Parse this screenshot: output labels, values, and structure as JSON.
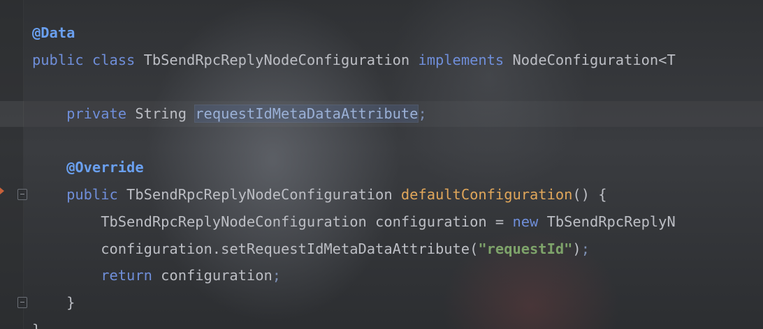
{
  "editor": {
    "lines": [
      {
        "tokens": [
          {
            "cls": "ann-blue",
            "text": "@Data"
          }
        ]
      },
      {
        "tokens": [
          {
            "cls": "kw",
            "text": "public class "
          },
          {
            "cls": "ty",
            "text": "TbSendRpcReplyNodeConfiguration "
          },
          {
            "cls": "kw",
            "text": "implements "
          },
          {
            "cls": "ty",
            "text": "NodeConfiguration<T"
          }
        ]
      },
      {
        "tokens": []
      },
      {
        "tokens": [
          {
            "cls": "kw",
            "text": "    private "
          },
          {
            "cls": "ty",
            "text": "String "
          },
          {
            "cls": "field-hl",
            "text": "requestIdMetaDataAttribute"
          },
          {
            "cls": "semi",
            "text": ";"
          }
        ]
      },
      {
        "tokens": []
      },
      {
        "tokens": [
          {
            "cls": "ann-blue",
            "text": "    @Override"
          }
        ]
      },
      {
        "tokens": [
          {
            "cls": "kw",
            "text": "    public "
          },
          {
            "cls": "ty",
            "text": "TbSendRpcReplyNodeConfiguration "
          },
          {
            "cls": "fn",
            "text": "defaultConfiguration"
          },
          {
            "cls": "punc",
            "text": "() {"
          }
        ]
      },
      {
        "tokens": [
          {
            "cls": "ty",
            "text": "        TbSendRpcReplyNodeConfiguration configuration = "
          },
          {
            "cls": "kw",
            "text": "new "
          },
          {
            "cls": "ty",
            "text": "TbSendRpcReplyN"
          }
        ]
      },
      {
        "tokens": [
          {
            "cls": "ty",
            "text": "        configuration.setRequestIdMetaDataAttribute("
          },
          {
            "cls": "str",
            "text": "\"requestId\""
          },
          {
            "cls": "punc",
            "text": ")"
          },
          {
            "cls": "semi",
            "text": ";"
          }
        ]
      },
      {
        "tokens": [
          {
            "cls": "kw",
            "text": "        return "
          },
          {
            "cls": "ty",
            "text": "configuration"
          },
          {
            "cls": "semi",
            "text": ";"
          }
        ]
      },
      {
        "tokens": [
          {
            "cls": "punc",
            "text": "    }"
          }
        ]
      },
      {
        "tokens": [
          {
            "cls": "punc",
            "text": "}"
          }
        ]
      }
    ]
  },
  "gutter": {
    "icons": [
      "fold-open-icon",
      "fold-close-icon",
      "breakpoint-marker-icon"
    ]
  }
}
